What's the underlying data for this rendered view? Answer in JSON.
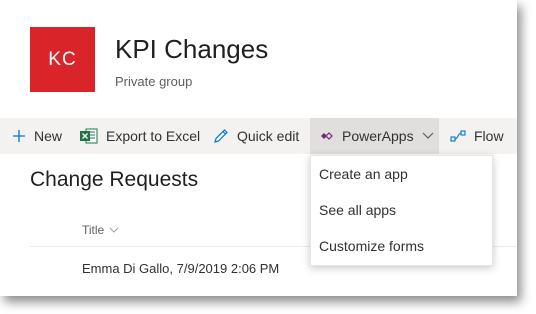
{
  "site": {
    "logo_text": "KC",
    "logo_color": "#d9252a",
    "title": "KPI Changes",
    "subtitle": "Private group"
  },
  "commandbar": {
    "new_label": "New",
    "export_label": "Export to Excel",
    "quickedit_label": "Quick edit",
    "powerapps_label": "PowerApps",
    "flow_label": "Flow"
  },
  "list": {
    "title": "Change Requests",
    "column_title": "Title",
    "rows": [
      "Emma Di Gallo, 7/9/2019 2:06 PM"
    ]
  },
  "powerapps_menu": {
    "items": [
      "Create an app",
      "See all apps",
      "Customize forms"
    ]
  },
  "icons": {
    "new": "plus-icon",
    "export": "excel-icon",
    "quickedit": "pencil-icon",
    "powerapps": "powerapps-icon",
    "dropdown": "chevron-down-icon",
    "flow": "flow-icon",
    "sort": "chevron-down-icon"
  },
  "colors": {
    "accent": "#0078d4",
    "excel": "#217346"
  }
}
